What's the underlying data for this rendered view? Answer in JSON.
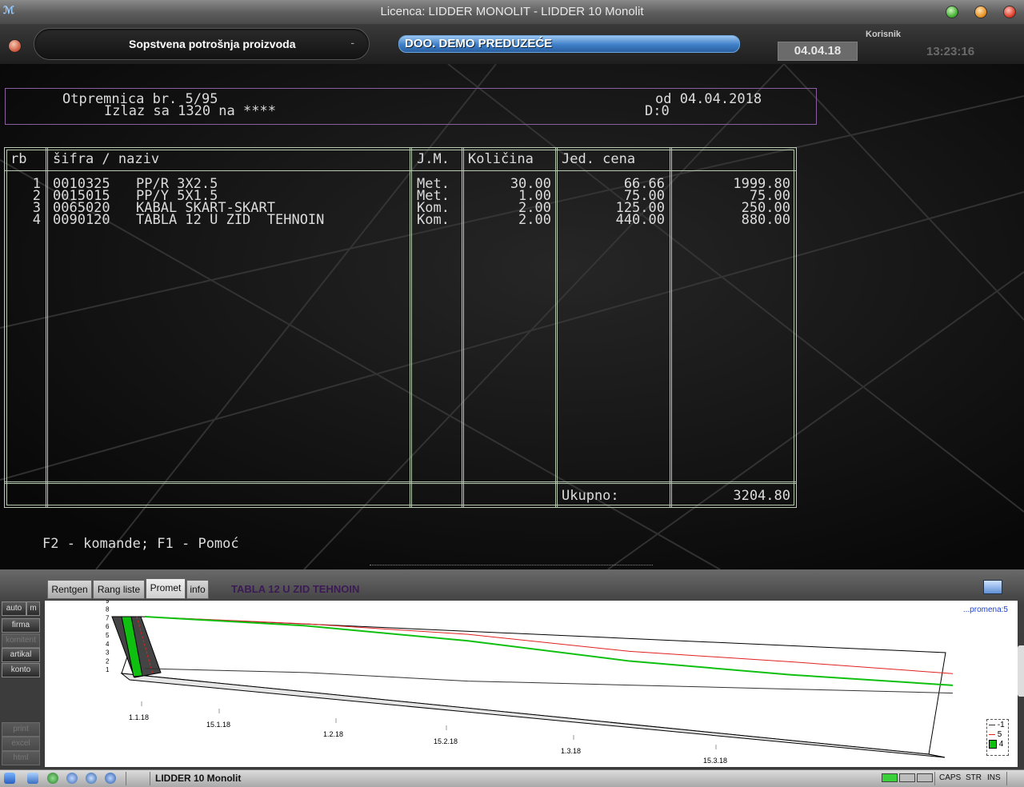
{
  "window": {
    "title": "Licenca: LIDDER MONOLIT - LIDDER 10 Monolit"
  },
  "header": {
    "module_title": "Sopstvena potrošnja proizvoda",
    "module_dash": "-",
    "company": "DOO. DEMO PREDUZEĆE",
    "date": "04.04.18",
    "user_label": "Korisnik",
    "time": "13:23:16"
  },
  "document": {
    "title": "Otpremnica br. 5/95",
    "subtitle": "Izlaz sa 1320 na ****",
    "date_text": "od 04.04.2018",
    "d_text": "D:0"
  },
  "table": {
    "headers": [
      "rb",
      "šifra / naziv",
      "J.M.",
      "Količina",
      "Jed. cena",
      ""
    ],
    "rows": [
      {
        "rb": "1",
        "code": "0010325",
        "name": "PP/R 3X2.5",
        "unit": "Met.",
        "qty": "30.00",
        "price": "66.66",
        "total": "1999.80"
      },
      {
        "rb": "2",
        "code": "0015015",
        "name": "PP/Y 5X1.5",
        "unit": "Met.",
        "qty": "1.00",
        "price": "75.00",
        "total": "75.00"
      },
      {
        "rb": "3",
        "code": "0065020",
        "name": "KABAL SKART-SKART",
        "unit": "Kom.",
        "qty": "2.00",
        "price": "125.00",
        "total": "250.00"
      },
      {
        "rb": "4",
        "code": "0090120",
        "name": "TABLA 12 U ZID  TEHNOIN",
        "unit": "Kom.",
        "qty": "2.00",
        "price": "440.00",
        "total": "880.00"
      }
    ],
    "total_label": "Ukupno:",
    "total_value": "3204.80"
  },
  "help_text": "F2 - komande; F1 - Pomoć",
  "panel": {
    "tabs": [
      "Rentgen",
      "Rang liste",
      "Promet",
      "info"
    ],
    "active_tab": "Promet",
    "product_name": "TABLA 12 U ZID  TEHNOIN",
    "side_buttons": {
      "auto": "auto",
      "m": "m",
      "firma": "firma",
      "komitent": "komitent",
      "artikal": "artikal",
      "konto": "konto",
      "print": "print",
      "excel": "excel",
      "html": "html"
    },
    "promena_label": "...promena:5"
  },
  "chart_data": {
    "type": "line",
    "x_ticks": [
      "1.1.18",
      "15.1.18",
      "1.2.18",
      "15.2.18",
      "1.3.18",
      "15.3.18"
    ],
    "y_ticks": [
      "1",
      "2",
      "3",
      "4",
      "5",
      "6",
      "7",
      "8",
      "9"
    ],
    "ylim": [
      0,
      9
    ],
    "series": [
      {
        "name": "-1",
        "color": "#333333",
        "values": [
          1,
          1,
          0.3,
          0.3,
          0.3,
          0.3
        ]
      },
      {
        "name": "5",
        "color": "#e02020",
        "values": [
          9,
          8.5,
          7.5,
          5.5,
          4.5,
          3.3
        ]
      },
      {
        "name": "4",
        "color": "#10c010",
        "values": [
          9,
          8.2,
          6.5,
          4.0,
          2.5,
          1.5
        ]
      }
    ],
    "legend": "bottom-right"
  },
  "taskbar": {
    "app_label": "LIDDER 10 Monolit",
    "caps": "CAPS",
    "str": "STR",
    "ins": "INS"
  }
}
